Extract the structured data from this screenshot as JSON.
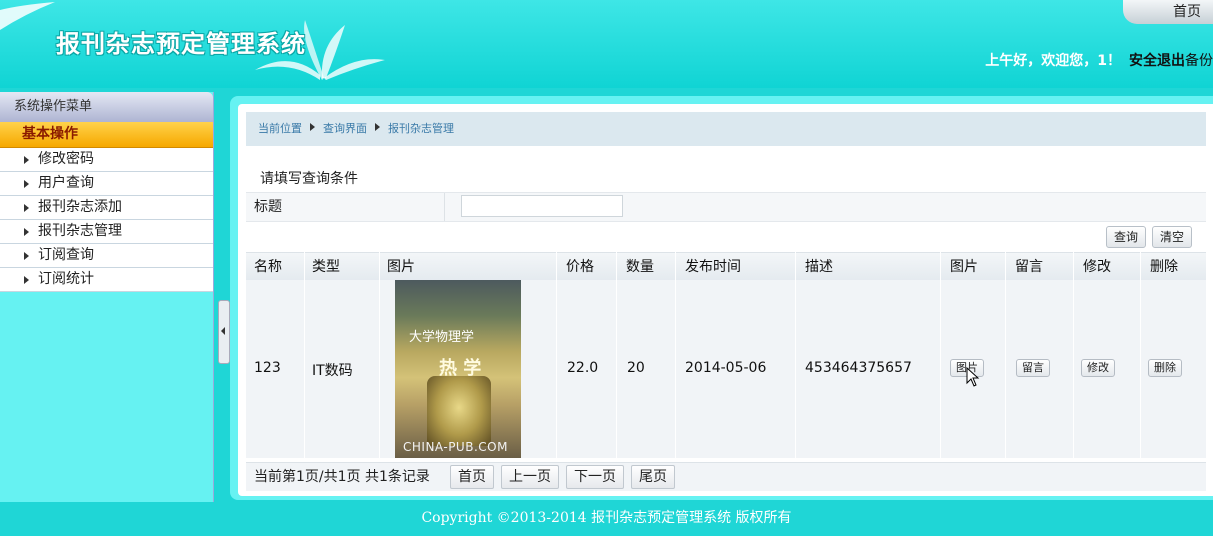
{
  "header": {
    "system_title": "报刊杂志预定管理系统",
    "home_tab": "首页",
    "greeting": "上午好，欢迎您，1！",
    "logout": "安全退出",
    "backup": "备份"
  },
  "sidebar": {
    "title": "系统操作菜单",
    "group": "基本操作",
    "items": [
      {
        "label": "修改密码"
      },
      {
        "label": "用户查询"
      },
      {
        "label": "报刊杂志添加"
      },
      {
        "label": "报刊杂志管理"
      },
      {
        "label": "订阅查询"
      },
      {
        "label": "订阅统计"
      }
    ]
  },
  "breadcrumb": [
    "当前位置",
    "查询界面",
    "报刊杂志管理"
  ],
  "search": {
    "heading": "请填写查询条件",
    "title_label": "标题",
    "title_value": "",
    "query_button": "查询",
    "clear_button": "清空"
  },
  "table": {
    "columns": [
      "名称",
      "类型",
      "图片",
      "价格",
      "数量",
      "发布时间",
      "描述",
      "图片",
      "留言",
      "修改",
      "删除"
    ],
    "rows": [
      {
        "name": "123",
        "type": "IT数码",
        "cover_title": "大学物理学",
        "cover_subtitle": "热 学",
        "cover_watermark": "CHINA-PUB.COM",
        "price": "22.0",
        "quantity": "20",
        "publish_date": "2014-05-06",
        "description": "453464375657",
        "image_btn": "图片",
        "comment_btn": "留言",
        "edit_btn": "修改",
        "delete_btn": "删除"
      }
    ]
  },
  "pager": {
    "info": "当前第1页/共1页  共1条记录",
    "first": "首页",
    "prev": "上一页",
    "next": "下一页",
    "last": "尾页"
  },
  "footer": "Copyright ©2013-2014 报刊杂志预定管理系统 版权所有"
}
